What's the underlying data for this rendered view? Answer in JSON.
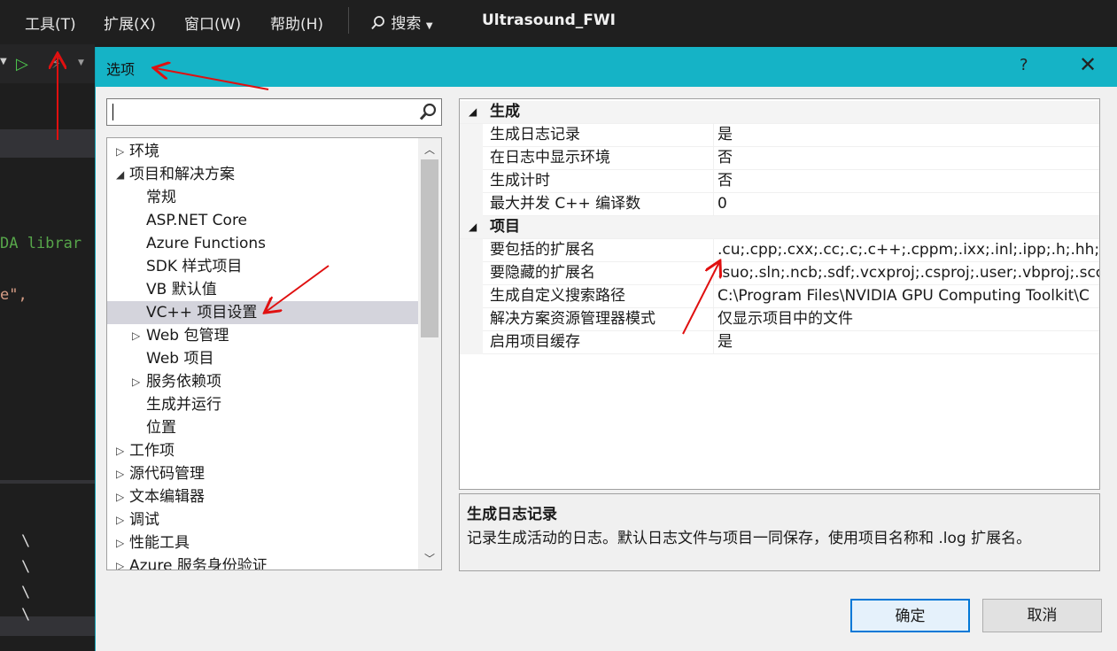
{
  "menubar": {
    "items": [
      "工具(T)",
      "扩展(X)",
      "窗口(W)",
      "帮助(H)"
    ],
    "search_label": "搜索",
    "solution_title": "Ultrasound_FWI"
  },
  "editor": {
    "lines": [
      "DA librar",
      "e\",",
      "\\",
      "\\",
      "\\",
      "\\"
    ]
  },
  "dialog": {
    "title": "选项",
    "help_label": "?",
    "close_label": "✕",
    "search": {
      "value": "",
      "placeholder": ""
    },
    "tree": [
      {
        "label": "环境",
        "level": 0,
        "expander": "collapsed"
      },
      {
        "label": "项目和解决方案",
        "level": 0,
        "expander": "expanded"
      },
      {
        "label": "常规",
        "level": 1,
        "expander": "none"
      },
      {
        "label": "ASP.NET Core",
        "level": 1,
        "expander": "none"
      },
      {
        "label": "Azure Functions",
        "level": 1,
        "expander": "none"
      },
      {
        "label": "SDK 样式项目",
        "level": 1,
        "expander": "none"
      },
      {
        "label": "VB 默认值",
        "level": 1,
        "expander": "none"
      },
      {
        "label": "VC++ 项目设置",
        "level": 1,
        "expander": "none",
        "selected": true
      },
      {
        "label": "Web 包管理",
        "level": 1,
        "expander": "collapsed"
      },
      {
        "label": "Web 项目",
        "level": 1,
        "expander": "none"
      },
      {
        "label": "服务依赖项",
        "level": 1,
        "expander": "collapsed"
      },
      {
        "label": "生成并运行",
        "level": 1,
        "expander": "none"
      },
      {
        "label": "位置",
        "level": 1,
        "expander": "none"
      },
      {
        "label": "工作项",
        "level": 0,
        "expander": "collapsed"
      },
      {
        "label": "源代码管理",
        "level": 0,
        "expander": "collapsed"
      },
      {
        "label": "文本编辑器",
        "level": 0,
        "expander": "collapsed"
      },
      {
        "label": "调试",
        "level": 0,
        "expander": "collapsed"
      },
      {
        "label": "性能工具",
        "level": 0,
        "expander": "collapsed"
      },
      {
        "label": "Azure 服务身份验证",
        "level": 0,
        "expander": "collapsed"
      }
    ],
    "grid": [
      {
        "category": "生成",
        "rows": [
          {
            "name": "生成日志记录",
            "value": "是"
          },
          {
            "name": "在日志中显示环境",
            "value": "否"
          },
          {
            "name": "生成计时",
            "value": "否"
          },
          {
            "name": "最大并发 C++ 编译数",
            "value": "0"
          }
        ]
      },
      {
        "category": "项目",
        "rows": [
          {
            "name": "要包括的扩展名",
            "value": ".cu;.cpp;.cxx;.cc;.c;.c++;.cppm;.ixx;.inl;.ipp;.h;.hh;.hpp"
          },
          {
            "name": "要隐藏的扩展名",
            "value": ".suo;.sln;.ncb;.sdf;.vcxproj;.csproj;.user;.vbproj;.scc;.vs"
          },
          {
            "name": "生成自定义搜索路径",
            "value": "C:\\Program Files\\NVIDIA GPU Computing Toolkit\\C"
          },
          {
            "name": "解决方案资源管理器模式",
            "value": "仅显示项目中的文件"
          },
          {
            "name": "启用项目缓存",
            "value": "是"
          }
        ]
      }
    ],
    "description": {
      "title": "生成日志记录",
      "text": "记录生成活动的日志。默认日志文件与项目一同保存，使用项目名称和 .log 扩展名。"
    },
    "buttons": {
      "ok": "确定",
      "cancel": "取消"
    }
  },
  "colors": {
    "title_bar": "#15b3c6",
    "selection": "#d4d4dc",
    "annotation_arrow": "#e01010",
    "ok_border": "#0078d7"
  }
}
